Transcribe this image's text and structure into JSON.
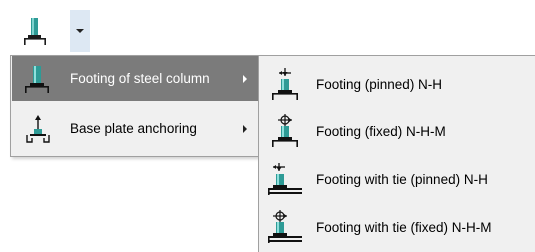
{
  "toolbar": {
    "main_icon": "footing-steel-column-icon",
    "dropdown_icon": "chevron-down-icon"
  },
  "menu": {
    "items": [
      {
        "label": "Footing of steel column",
        "icon": "footing-steel-column-icon",
        "has_submenu": true,
        "active": true
      },
      {
        "label": "Base plate anchoring",
        "icon": "base-plate-anchoring-icon",
        "has_submenu": true,
        "active": false
      }
    ]
  },
  "submenu": {
    "items": [
      {
        "label": "Footing (pinned) N-H",
        "icon": "footing-pinned-icon"
      },
      {
        "label": "Footing (fixed) N-H-M",
        "icon": "footing-fixed-icon"
      },
      {
        "label": "Footing with tie (pinned) N-H",
        "icon": "footing-tie-pinned-icon"
      },
      {
        "label": "Footing with tie (fixed) N-H-M",
        "icon": "footing-tie-fixed-icon"
      }
    ]
  },
  "colors": {
    "menu_bg": "#f0f0f0",
    "active_bg": "#7b7b7b",
    "column_teal": "#2e9b96",
    "dropdown_hover": "#dde8f3"
  }
}
